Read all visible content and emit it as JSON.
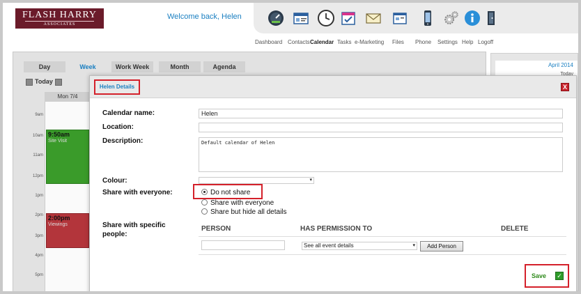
{
  "header": {
    "logo_line1": "FLASH HARRY",
    "logo_line2": "ASSOCIATES",
    "welcome": "Welcome back, Helen",
    "nav": [
      {
        "label": "Dashboard",
        "icon": "gauge-icon"
      },
      {
        "label": "Contacts",
        "icon": "contacts-card-icon"
      },
      {
        "label": "Calendar",
        "icon": "clock-icon",
        "active": true
      },
      {
        "label": "Tasks",
        "icon": "tasks-checklist-icon"
      },
      {
        "label": "e-Marketing",
        "icon": "envelope-icon"
      },
      {
        "label": "Files",
        "icon": "files-icon"
      },
      {
        "label": "Phone",
        "icon": "phone-icon"
      },
      {
        "label": "Settings",
        "icon": "gear-icon"
      },
      {
        "label": "Help",
        "icon": "info-icon"
      },
      {
        "label": "Logoff",
        "icon": "logoff-icon"
      }
    ]
  },
  "calendar": {
    "views": [
      "Day",
      "Week",
      "Work Week",
      "Month",
      "Agenda"
    ],
    "active_view": "Week",
    "today_label": "Today",
    "day_header": "Mon 7/4",
    "times": [
      "9am",
      "10am",
      "11am",
      "12pm",
      "1pm",
      "2pm",
      "3pm",
      "4pm",
      "5pm"
    ],
    "events": [
      {
        "time": "9:50am",
        "name": "Site Visit",
        "color": "#3a9b2a"
      },
      {
        "time": "2:00pm",
        "name": "Viewings",
        "color": "#b3353b"
      }
    ],
    "mini_month": "April 2014",
    "mini_today": "Today"
  },
  "modal": {
    "title": "Helen Details",
    "close_label": "X",
    "fields": {
      "calendar_name_label": "Calendar name:",
      "calendar_name_value": "Helen",
      "location_label": "Location:",
      "location_value": "",
      "description_label": "Description:",
      "description_value": "Default calendar of Helen",
      "colour_label": "Colour:",
      "share_label": "Share with everyone:",
      "share_options": [
        "Do not share",
        "Share with everyone",
        "Share but hide all details"
      ],
      "share_selected": 0,
      "share_specific_label_1": "Share with specific",
      "share_specific_label_2": "people:"
    },
    "table": {
      "headers": [
        "PERSON",
        "HAS PERMISSION TO",
        "DELETE"
      ],
      "permission_value": "See all event details",
      "add_person_label": "Add Person"
    },
    "save_label": "Save",
    "accent_red": "#d4202a",
    "link_blue": "#1a7fc1"
  }
}
